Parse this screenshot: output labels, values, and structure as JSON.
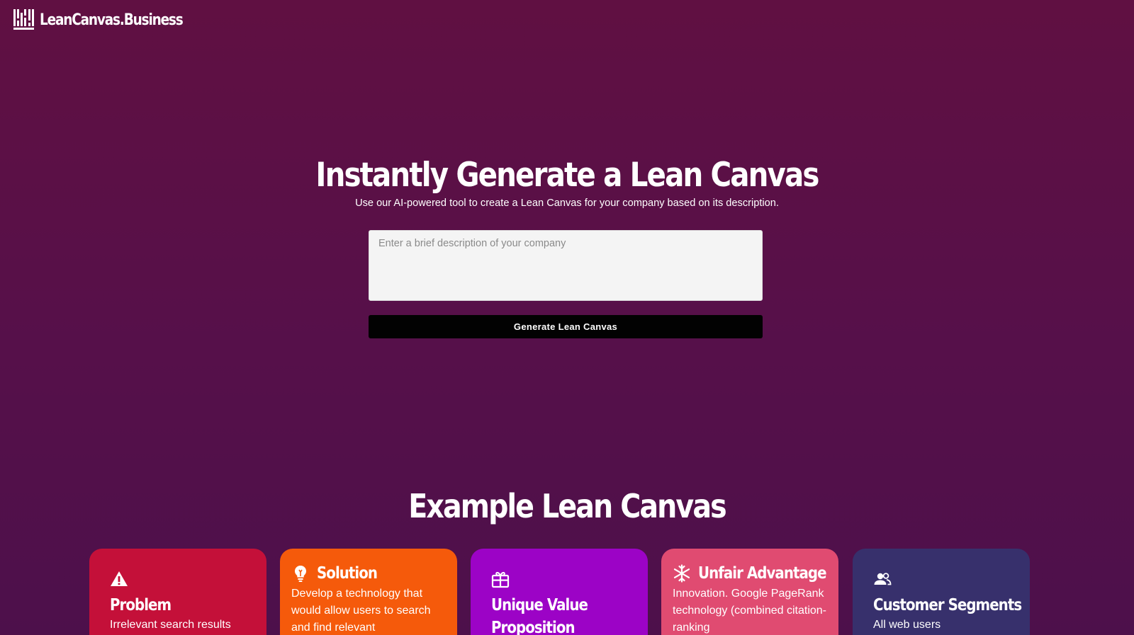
{
  "brand": {
    "name": "LeanCanvas.Business",
    "icon": "building-columns-icon"
  },
  "hero": {
    "title": "Instantly Generate a Lean Canvas",
    "subtitle": "Use our AI-powered tool to create a Lean Canvas for your company based on its description.",
    "input_value": "",
    "input_placeholder": "Enter a brief description of your company",
    "button_label": "Generate Lean Canvas"
  },
  "example": {
    "title": "Example Lean Canvas",
    "cards": [
      {
        "key": "problem",
        "title": "Problem",
        "icon": "warning-triangle-icon",
        "color": "#c41039",
        "text": "Irrelevant search results"
      },
      {
        "key": "solution",
        "title": "Solution",
        "icon": "lightbulb-icon",
        "color": "#f55a0b",
        "text": "Develop a technology that would allow users to search and find relevant"
      },
      {
        "key": "uvp",
        "title": "Unique Value Proposition",
        "icon": "gift-icon",
        "color": "#9c03c6",
        "text": ""
      },
      {
        "key": "unfair",
        "title": "Unfair Advantage",
        "icon": "snowflake-icon",
        "color": "#e04b71",
        "text": "Innovation. Google PageRank technology (combined citation-ranking"
      },
      {
        "key": "segments",
        "title": "Customer Segments",
        "icon": "users-icon",
        "color": "#37306c",
        "text": "All web users"
      }
    ]
  }
}
